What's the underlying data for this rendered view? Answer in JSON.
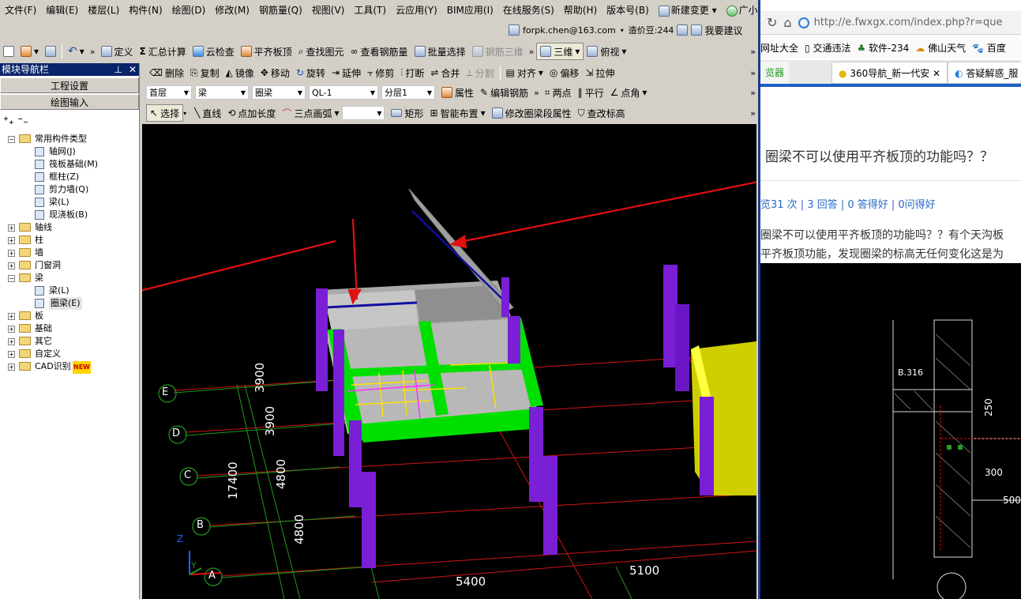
{
  "menu": [
    "文件(F)",
    "编辑(E)",
    "楼层(L)",
    "构件(N)",
    "绘图(D)",
    "修改(M)",
    "钢筋量(Q)",
    "视图(V)",
    "工具(T)",
    "云应用(Y)",
    "BIM应用(I)",
    "在线服务(S)",
    "帮助(H)",
    "版本号(B)",
    "新建变更",
    "广小二"
  ],
  "account": {
    "user": "forpk.chen@163.com",
    "beans": "造价豆:244",
    "suggest": "我要建议"
  },
  "toolbar1": {
    "define": "定义",
    "summary": "汇总计算",
    "cloud_check": "云检查",
    "flush_top": "平齐板顶",
    "find": "查找图元",
    "view_rebar": "查看钢筋量",
    "batch": "批量选择",
    "rebar3d": "钢筋三维",
    "view3d": "三维",
    "topview": "俯视"
  },
  "toolbar2": {
    "delete": "删除",
    "copy": "复制",
    "mirror": "镜像",
    "move": "移动",
    "rotate": "旋转",
    "extend": "延伸",
    "trim": "修剪",
    "break": "打断",
    "merge": "合并",
    "split": "分割",
    "align": "对齐",
    "offset": "偏移",
    "stretch": "拉伸"
  },
  "toolbar3": {
    "floor": "首层",
    "type": "梁",
    "sub": "圈梁",
    "name": "QL-1",
    "layer": "分层1",
    "prop": "属性",
    "edit_rebar": "编辑钢筋",
    "two_points": "两点",
    "parallel": "平行",
    "angle": "点角"
  },
  "toolbar4": {
    "select": "选择",
    "line": "直线",
    "point_len": "点加长度",
    "arc": "三点画弧",
    "rect": "矩形",
    "smart": "智能布置",
    "modify_seg": "修改圈梁段属性",
    "check_elev": "查改标高"
  },
  "nav": {
    "title": "模块导航栏",
    "btn1": "工程设置",
    "btn2": "绘图输入",
    "tree": [
      {
        "label": "常用构件类型",
        "lvl": 0,
        "exp": "−",
        "folder": true
      },
      {
        "label": "轴网(J)",
        "lvl": 1
      },
      {
        "label": "筏板基础(M)",
        "lvl": 1
      },
      {
        "label": "框柱(Z)",
        "lvl": 1
      },
      {
        "label": "剪力墙(Q)",
        "lvl": 1
      },
      {
        "label": "梁(L)",
        "lvl": 1
      },
      {
        "label": "现浇板(B)",
        "lvl": 1
      },
      {
        "label": "轴线",
        "lvl": 0,
        "exp": "+",
        "folder": true
      },
      {
        "label": "柱",
        "lvl": 0,
        "exp": "+",
        "folder": true
      },
      {
        "label": "墙",
        "lvl": 0,
        "exp": "+",
        "folder": true
      },
      {
        "label": "门窗洞",
        "lvl": 0,
        "exp": "+",
        "folder": true
      },
      {
        "label": "梁",
        "lvl": 0,
        "exp": "−",
        "folder": true
      },
      {
        "label": "梁(L)",
        "lvl": 1
      },
      {
        "label": "圈梁(E)",
        "lvl": 1,
        "sel": true
      },
      {
        "label": "板",
        "lvl": 0,
        "exp": "+",
        "folder": true
      },
      {
        "label": "基础",
        "lvl": 0,
        "exp": "+",
        "folder": true
      },
      {
        "label": "其它",
        "lvl": 0,
        "exp": "+",
        "folder": true
      },
      {
        "label": "自定义",
        "lvl": 0,
        "exp": "+",
        "folder": true
      },
      {
        "label": "CAD识别",
        "lvl": 0,
        "exp": "+",
        "folder": true,
        "badge": "NEW"
      }
    ]
  },
  "viewport": {
    "axis_rows": [
      "E",
      "D",
      "C",
      "B",
      "A"
    ],
    "dims_y": [
      "3900",
      "3900",
      "4800",
      "4800"
    ],
    "total_y": "17400",
    "dims_x": [
      "5400",
      "5100"
    ],
    "axis_z": "Z",
    "axis_y": "Y"
  },
  "browser": {
    "url": "http://e.fwxgx.com/index.php?r=que",
    "bookmarks": [
      "网址大全",
      "交通违法",
      "软件-234",
      "佛山天气",
      "百度"
    ],
    "tabs": [
      "览器",
      "360导航_新一代安",
      "答疑解惑_服"
    ],
    "question": "圈梁不可以使用平齐板顶的功能吗？？",
    "stats": "览31 次 | 3 回答 | 0 答得好 | 0问得好",
    "body1": "圈梁不可以使用平齐板顶的功能吗？？有个天沟板",
    "body2": "平齐板顶功能，发现圈梁的标高无任何变化这是为",
    "drawing": {
      "b316": "B.316",
      "d250": "250",
      "d300": "300",
      "d500": "500"
    }
  },
  "colors": {
    "beam": "#00e000",
    "column": "#7a1fd6",
    "slab": "#bdbdbd",
    "arrow": "#e01010",
    "grid_red": "#d21414",
    "grid_green": "#1f9a1f",
    "bluebar": "#0a246a"
  }
}
